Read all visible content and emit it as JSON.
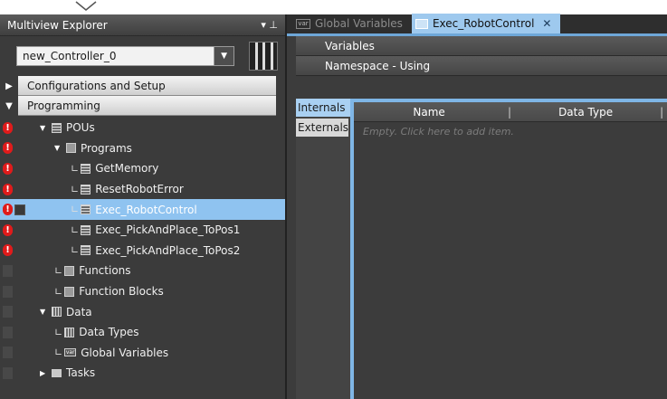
{
  "explorer": {
    "title": "Multiview Explorer",
    "pin_glyph": "▾ ⊥",
    "controller": "new_Controller_0",
    "sections": [
      {
        "label": "Configurations and Setup",
        "expanded": false
      },
      {
        "label": "Programming",
        "expanded": true
      }
    ],
    "tree": [
      {
        "label": "POUs",
        "indent": 1,
        "expander": "▼",
        "icon": "doc-icon",
        "error": true,
        "selected": false,
        "ell": false
      },
      {
        "label": "Programs",
        "indent": 2,
        "expander": "▼",
        "icon": "programs-icon",
        "error": true,
        "selected": false,
        "ell": false
      },
      {
        "label": "GetMemory",
        "indent": 3,
        "expander": "",
        "icon": "program-icon",
        "error": true,
        "selected": false,
        "ell": true
      },
      {
        "label": "ResetRobotError",
        "indent": 3,
        "expander": "",
        "icon": "program-icon",
        "error": true,
        "selected": false,
        "ell": true
      },
      {
        "label": "Exec_RobotControl",
        "indent": 3,
        "expander": "",
        "icon": "program-icon",
        "error": true,
        "selected": true,
        "ell": true
      },
      {
        "label": "Exec_PickAndPlace_ToPos1",
        "indent": 3,
        "expander": "",
        "icon": "program-icon",
        "error": true,
        "selected": false,
        "ell": true
      },
      {
        "label": "Exec_PickAndPlace_ToPos2",
        "indent": 3,
        "expander": "",
        "icon": "program-icon",
        "error": true,
        "selected": false,
        "ell": true
      },
      {
        "label": "Functions",
        "indent": 2,
        "expander": "",
        "icon": "functions-icon",
        "error": false,
        "selected": false,
        "ell": true
      },
      {
        "label": "Function Blocks",
        "indent": 2,
        "expander": "",
        "icon": "function-blocks-icon",
        "error": false,
        "selected": false,
        "ell": true
      },
      {
        "label": "Data",
        "indent": 1,
        "expander": "▼",
        "icon": "data-icon",
        "error": false,
        "selected": false,
        "ell": false
      },
      {
        "label": "Data Types",
        "indent": 2,
        "expander": "",
        "icon": "data-types-icon",
        "error": false,
        "selected": false,
        "ell": true
      },
      {
        "label": "Global Variables",
        "indent": 2,
        "expander": "",
        "icon": "global-variables-icon",
        "error": false,
        "selected": false,
        "ell": true
      },
      {
        "label": "Tasks",
        "indent": 1,
        "expander": "▶",
        "icon": "tasks-icon",
        "error": false,
        "selected": false,
        "ell": false
      }
    ]
  },
  "editor": {
    "tabs": [
      {
        "label": "Global Variables",
        "icon_text": "var",
        "active": false
      },
      {
        "label": "Exec_RobotControl",
        "icon_text": "",
        "active": true
      }
    ],
    "close_glyph": "✕",
    "variables_label": "Variables",
    "namespace_label": "Namespace - Using",
    "side_tabs": [
      "Internals",
      "Externals"
    ],
    "columns": [
      "Name",
      "Data Type"
    ],
    "column_sep": "|",
    "empty_hint": "Empty. Click here to add item."
  },
  "colors": {
    "selection": "#8fc3f0",
    "active_tab": "#9ec9ee",
    "error": "#e01b1b",
    "grid_border": "#7fb6e6"
  }
}
